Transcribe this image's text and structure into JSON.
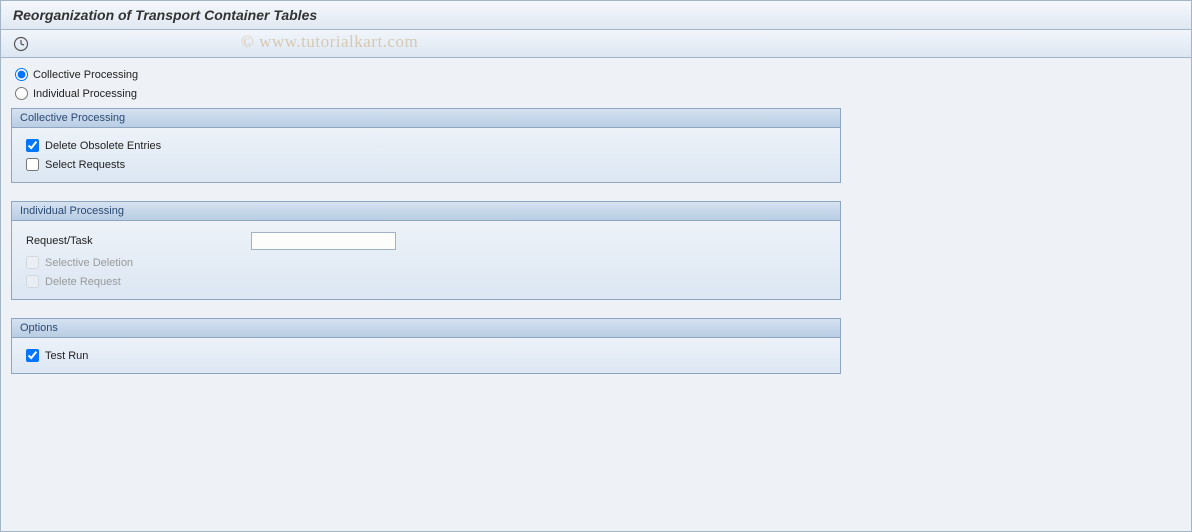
{
  "title": "Reorganization of Transport Container Tables",
  "watermark": "© www.tutorialkart.com",
  "processing": {
    "collective_label": "Collective Processing",
    "individual_label": "Individual Processing"
  },
  "collective_group": {
    "title": "Collective Processing",
    "delete_obsolete_label": "Delete Obsolete Entries",
    "select_requests_label": "Select Requests"
  },
  "individual_group": {
    "title": "Individual Processing",
    "request_task_label": "Request/Task",
    "request_task_value": "",
    "selective_deletion_label": "Selective Deletion",
    "delete_request_label": "Delete Request"
  },
  "options_group": {
    "title": "Options",
    "test_run_label": "Test Run"
  }
}
